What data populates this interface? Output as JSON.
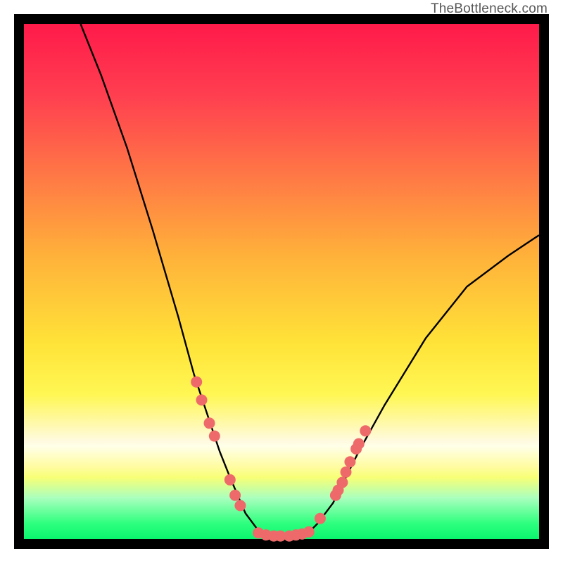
{
  "attribution": "TheBottleneck.com",
  "chart_data": {
    "type": "line",
    "title": "",
    "xlabel": "",
    "ylabel": "",
    "xlim": [
      0,
      100
    ],
    "ylim": [
      0,
      100
    ],
    "series": [
      {
        "name": "curve-left",
        "x": [
          11,
          15,
          20,
          25,
          30,
          33,
          36,
          38,
          40,
          43,
          46
        ],
        "y": [
          100,
          90,
          76,
          60,
          43,
          32,
          23,
          17,
          12,
          5,
          1
        ]
      },
      {
        "name": "curve-bottom",
        "x": [
          46,
          48,
          50,
          52,
          55
        ],
        "y": [
          1,
          0.6,
          0.5,
          0.6,
          1
        ]
      },
      {
        "name": "curve-right",
        "x": [
          55,
          57,
          60,
          65,
          70,
          78,
          86,
          94,
          100
        ],
        "y": [
          1,
          3,
          7,
          17,
          26,
          39,
          49,
          55,
          59
        ]
      }
    ],
    "markers_left": {
      "name": "dots-left",
      "x": [
        33.5,
        34.5,
        36.0,
        37.0,
        40.0,
        41.0,
        42.0
      ],
      "y": [
        30.5,
        27.0,
        22.5,
        20.0,
        11.5,
        8.5,
        6.5
      ]
    },
    "markers_right": {
      "name": "dots-right",
      "x": [
        57.5,
        60.5,
        61.0,
        61.8,
        62.5,
        63.3,
        64.5,
        65.0,
        66.3
      ],
      "y": [
        4.0,
        8.5,
        9.5,
        11.0,
        13.0,
        15.0,
        17.5,
        18.5,
        21.0
      ]
    },
    "markers_bottom": {
      "name": "dots-bottom",
      "x": [
        45.5,
        47.0,
        48.5,
        49.8,
        51.5,
        52.8,
        54.0,
        55.3
      ],
      "y": [
        1.2,
        0.8,
        0.6,
        0.6,
        0.6,
        0.8,
        1.0,
        1.4
      ]
    },
    "colors": {
      "curve": "#000000",
      "marker_fill": "#ee6a6a",
      "marker_stroke": "none"
    }
  }
}
